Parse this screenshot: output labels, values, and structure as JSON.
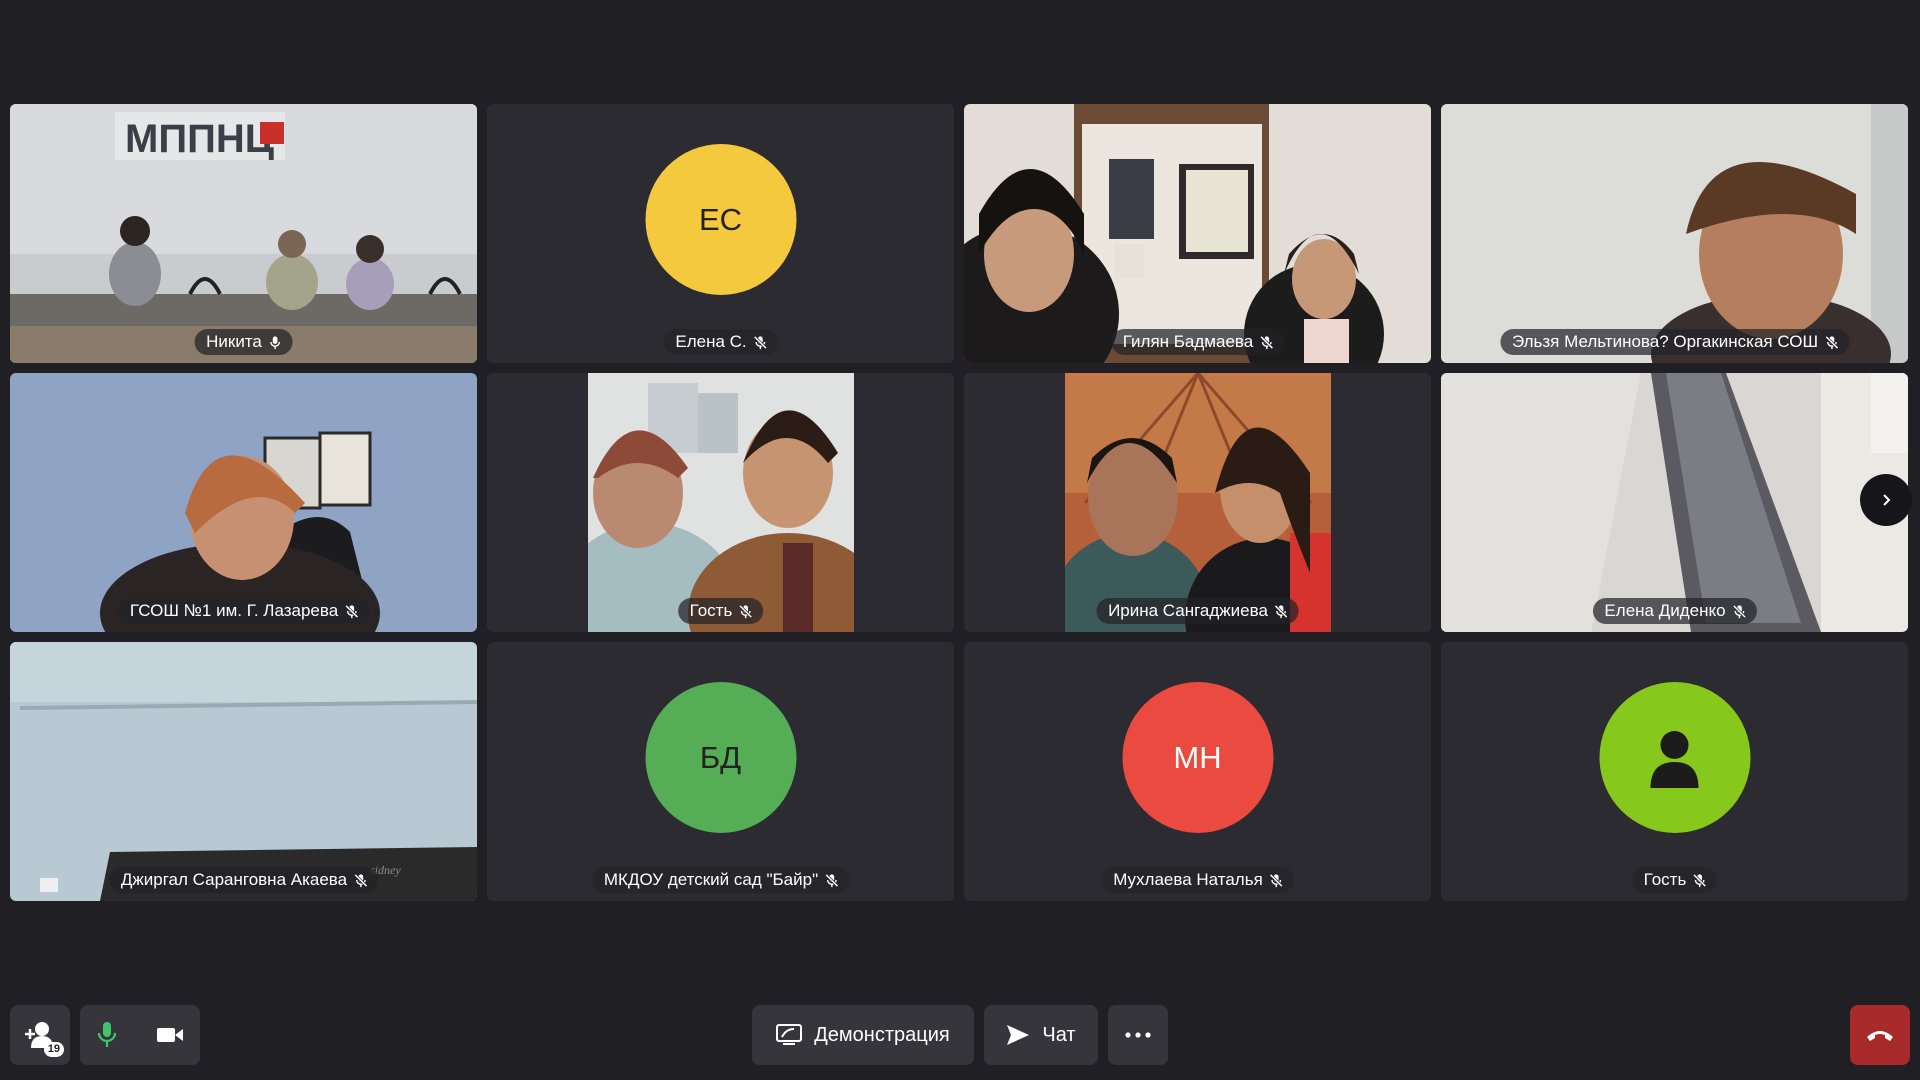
{
  "participants": [
    {
      "name": "Никита",
      "mic": "on",
      "type": "video",
      "scene": "conference-room",
      "active": true
    },
    {
      "name": "Елена С.",
      "mic": "muted",
      "type": "avatar",
      "initials": "ЕС",
      "color": "#f5c93e"
    },
    {
      "name": "Гилян Бадмаева",
      "mic": "muted",
      "type": "video",
      "scene": "office-bookshelf"
    },
    {
      "name": "Эльзя Мельтинова? Оргакинская СОШ",
      "mic": "muted",
      "type": "video",
      "scene": "closeup-woman"
    },
    {
      "name": "ГСОШ №1 им. Г. Лазарева",
      "mic": "muted",
      "type": "video",
      "scene": "woman-blue-wall"
    },
    {
      "name": "Гость",
      "mic": "muted",
      "type": "video",
      "scene": "two-women-narrow"
    },
    {
      "name": "Ирина Сангаджиева",
      "mic": "muted",
      "type": "video",
      "scene": "two-women-yurt"
    },
    {
      "name": "Елена Диденко",
      "mic": "muted",
      "type": "video",
      "scene": "monitor-wall"
    },
    {
      "name": "Джиргал Саранговна Акаева",
      "mic": "muted",
      "type": "video",
      "scene": "blackboard-wall"
    },
    {
      "name": "МКДОУ детский сад \"Байр\"",
      "mic": "muted",
      "type": "avatar",
      "initials": "БД",
      "color": "#55ad55"
    },
    {
      "name": "Мухлаева Наталья",
      "mic": "muted",
      "type": "avatar",
      "initials": "МН",
      "color": "#ea4a3f"
    },
    {
      "name": "Гость",
      "mic": "muted",
      "type": "avatar",
      "initials": "",
      "icon": "person-icon",
      "color": "#87c81c"
    }
  ],
  "logo_text": "МППНЦ",
  "toolbar": {
    "participants_count": "19",
    "screen_share_label": "Демонстрация",
    "chat_label": "Чат"
  },
  "colors": {
    "background": "#1f1f24",
    "tile": "#2b2b31",
    "active_border": "#f0c23c",
    "mic_on": "#3ec76a",
    "hangup": "#a82a2a"
  }
}
